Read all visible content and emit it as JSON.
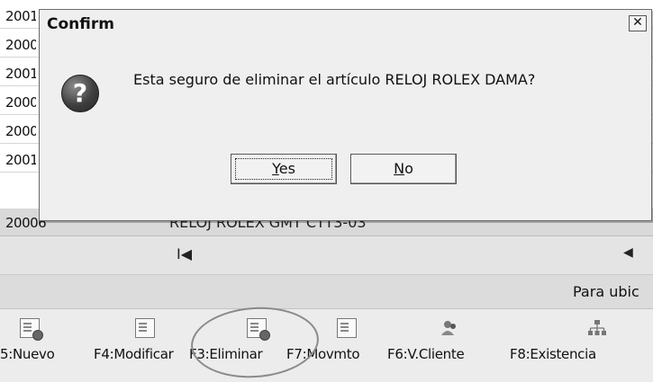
{
  "list": {
    "rows": [
      {
        "code": "2001"
      },
      {
        "code": "2000"
      },
      {
        "code": "2001"
      },
      {
        "code": "2000"
      },
      {
        "code": "2000"
      },
      {
        "code": "2001"
      },
      {
        "code": "20006",
        "description": "RELOJ ROLEX GMT CTT3-03"
      }
    ]
  },
  "nav": {
    "first_icon": "first-record-icon",
    "first_glyph": "I◀",
    "prev_icon": "previous-icon",
    "prev_glyph": "◀"
  },
  "hint": {
    "text": "Para ubic"
  },
  "toolbar": {
    "keys": [
      {
        "label": "5:Nuevo",
        "icon": "new-record-icon"
      },
      {
        "label": "F4:Modificar",
        "icon": "edit-record-icon"
      },
      {
        "label": "F3:Eliminar",
        "icon": "delete-record-icon"
      },
      {
        "label": "F7:Movmto",
        "icon": "movement-icon"
      },
      {
        "label": "F6:V.Cliente",
        "icon": "client-icon"
      },
      {
        "label": "F8:Existencia",
        "icon": "stock-tree-icon"
      }
    ]
  },
  "dialog": {
    "title": "Confirm",
    "close_glyph": "✕",
    "icon": "question-icon",
    "icon_glyph": "?",
    "message": "Esta seguro de eliminar el artículo RELOJ ROLEX DAMA?",
    "yes_mnemonic": "Y",
    "yes_rest": "es",
    "no_mnemonic": "N",
    "no_rest": "o"
  }
}
